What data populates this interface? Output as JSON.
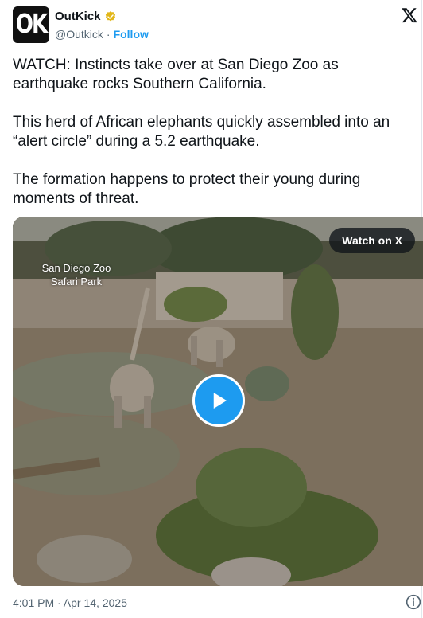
{
  "author": {
    "avatar_text": "OK",
    "name": "OutKick",
    "handle": "@Outkick",
    "separator": "·",
    "follow_label": "Follow"
  },
  "tweet": {
    "paragraphs": [
      "WATCH: Instincts take over at San Diego Zoo as earthquake rocks Southern California.",
      "This herd of African elephants quickly assembled into an “alert circle” during a 5.2 earthquake.",
      "The formation happens to protect their young during moments of threat."
    ],
    "timestamp": "4:01 PM · Apr 14, 2025"
  },
  "media": {
    "overlay_label_line1": "San Diego Zoo",
    "overlay_label_line2": "Safari Park",
    "watch_label": "Watch on X"
  },
  "colors": {
    "accent": "#1d9bf0",
    "verified_gold": "#e2b719",
    "text_secondary": "#536471"
  },
  "icons": [
    "verified-badge-icon",
    "x-logo-icon",
    "play-icon",
    "info-icon"
  ]
}
